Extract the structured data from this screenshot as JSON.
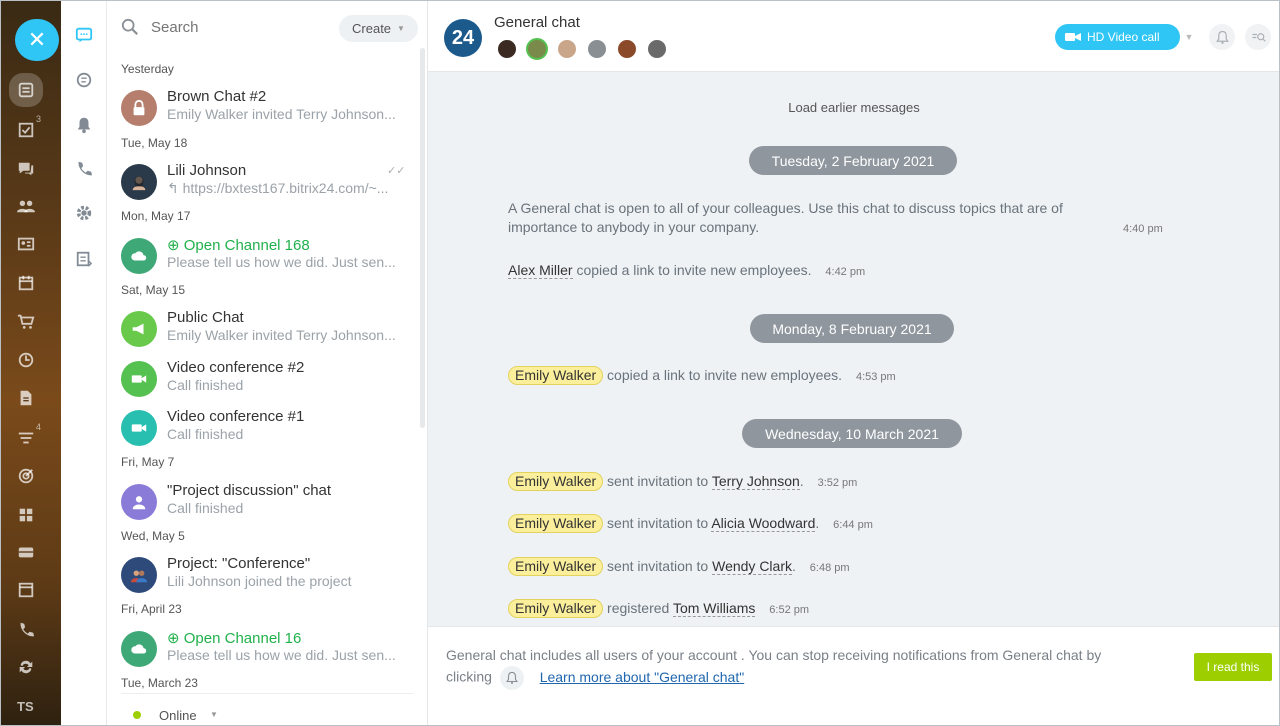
{
  "rail": {
    "close_glyph": "✕",
    "icons": [
      {
        "name": "feed-icon",
        "count": ""
      },
      {
        "name": "tasks-icon",
        "count": "3"
      },
      {
        "name": "chat-icon",
        "count": ""
      },
      {
        "name": "groups-icon",
        "count": ""
      },
      {
        "name": "contacts-icon",
        "count": ""
      },
      {
        "name": "calendar-icon",
        "count": ""
      },
      {
        "name": "cart-icon",
        "count": ""
      },
      {
        "name": "clock-icon",
        "count": ""
      },
      {
        "name": "document-icon",
        "count": ""
      },
      {
        "name": "filter-icon",
        "count": "4"
      },
      {
        "name": "target-icon",
        "count": ""
      },
      {
        "name": "apps-icon",
        "count": ""
      },
      {
        "name": "inbox-icon",
        "count": ""
      },
      {
        "name": "window-icon",
        "count": ""
      },
      {
        "name": "phone-icon",
        "count": ""
      },
      {
        "name": "sync-icon",
        "count": ""
      }
    ],
    "user_initials": "TS"
  },
  "search": {
    "placeholder": "Search"
  },
  "create_label": "Create",
  "recent": {
    "headers": [
      "Yesterday",
      "Tue, May 18",
      "Mon, May 17",
      "Sat, May 15",
      "Fri, May 7",
      "Wed, May 5",
      "Fri, April 23",
      "Tue, March 23"
    ],
    "items": [
      {
        "title": "Brown Chat #2",
        "sub": "Emily Walker invited Terry Johnson...",
        "color": "#b67e6d"
      },
      {
        "title": "Lili Johnson",
        "sub": "↰ https://bxtest167.bitrix24.com/~...",
        "color": "#2b3a4a"
      },
      {
        "title": "Open Channel 168",
        "sub": "Please tell us how we did. Just sen...",
        "color": "#3ea877"
      },
      {
        "title": "Public Chat",
        "sub": "Emily Walker invited Terry Johnson...",
        "color": "#68c94b"
      },
      {
        "title": "Video conference #2",
        "sub": "Call finished",
        "color": "#55c150"
      },
      {
        "title": "Video conference #1",
        "sub": "Call finished",
        "color": "#29bfb0"
      },
      {
        "title": "\"Project discussion\" chat",
        "sub": "Call finished",
        "color": "#8b7bd8"
      },
      {
        "title": "Project: \"Conference\"",
        "sub": "Lili Johnson joined the project",
        "color": "#2d4a7a"
      },
      {
        "title": "Open Channel 16",
        "sub": "Please tell us how we did. Just sen...",
        "color": "#3ea877"
      }
    ]
  },
  "status_label": "Online",
  "chat": {
    "logo": "24",
    "title": "General chat",
    "video_button": "HD Video call",
    "load_earlier": "Load earlier messages",
    "dates": [
      "Tuesday, 2 February 2021",
      "Monday, 8 February 2021",
      "Wednesday, 10 March 2021"
    ],
    "intro_text": "A General chat is open to all of your colleagues. Use this chat to discuss topics that are of importance to anybody in your company.",
    "intro_time": "4:40 pm",
    "messages": [
      {
        "user": "Alex Miller",
        "text": "copied a link to invite new employees.",
        "target": "",
        "time": "4:42 pm"
      },
      {
        "user": "Emily Walker",
        "text": "copied a link to invite new employees.",
        "target": "",
        "time": "4:53 pm"
      },
      {
        "user": "Emily Walker",
        "text": "sent invitation to",
        "target": "Terry Johnson",
        "time": "3:52 pm"
      },
      {
        "user": "Emily Walker",
        "text": "sent invitation to",
        "target": "Alicia Woodward",
        "time": "6:44 pm"
      },
      {
        "user": "Emily Walker",
        "text": "sent invitation to",
        "target": "Wendy Clark",
        "time": "6:48 pm"
      },
      {
        "user": "Emily Walker",
        "text": "registered",
        "target": "Tom Williams",
        "time": "6:52 pm"
      }
    ]
  },
  "notice": {
    "text": "General chat includes all users of your account . You can stop receiving notifications from General chat by clicking",
    "link": "Learn more about \"General chat\"",
    "button": "I read this"
  }
}
